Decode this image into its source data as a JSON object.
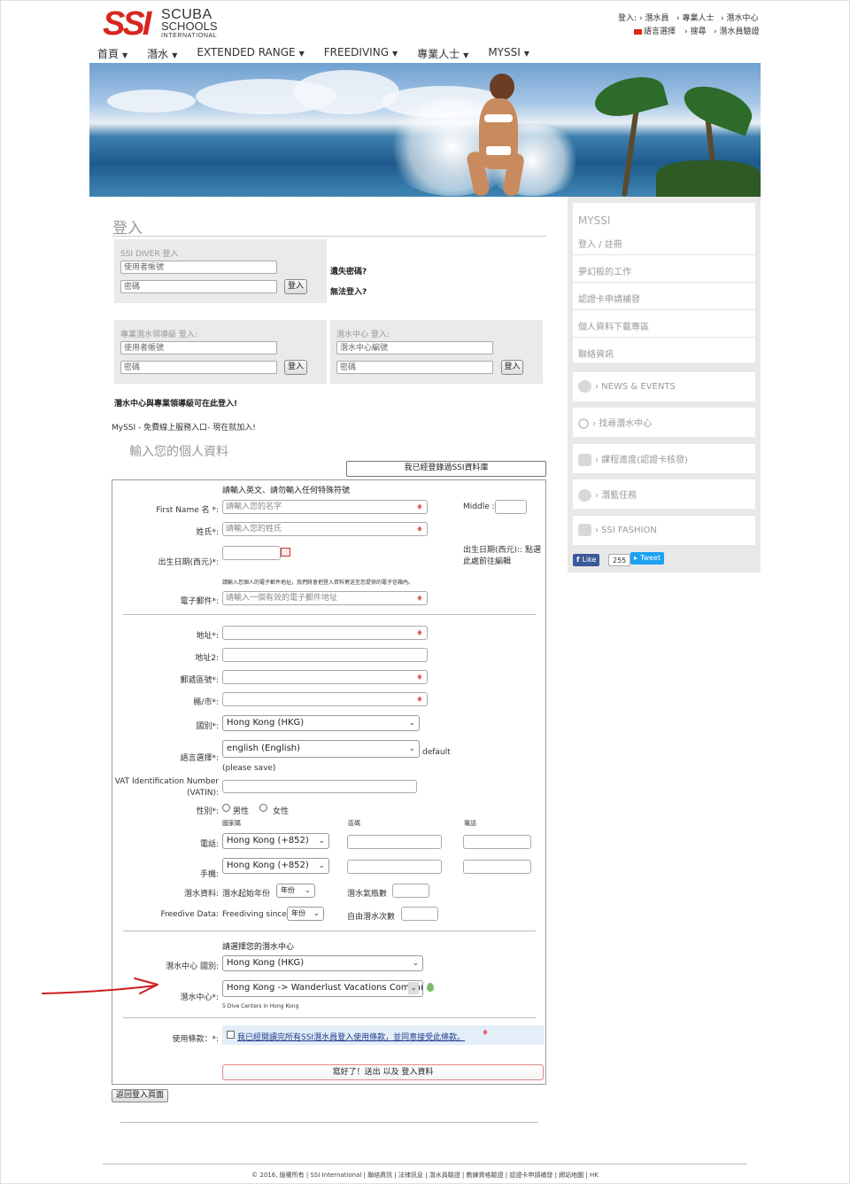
{
  "header": {
    "logo_ssi": "SSI",
    "logo_line1": "SCUBA",
    "logo_line2": "SCHOOLS",
    "logo_line3": "INTERNATIONAL",
    "top_login_label": "登入:",
    "top_links": [
      "› 潛水員",
      "› 專業人士",
      "› 潛水中心"
    ],
    "language_label": "語言選擇",
    "search_label": "› 搜尋",
    "verify_label": "› 潛水員驗證",
    "nav": [
      "首頁",
      "潛水",
      "EXTENDED RANGE",
      "FREEDIVING",
      "專業人士",
      "MYSSI"
    ]
  },
  "login": {
    "title": "登入",
    "diver_label": "SSI DIVER 登入",
    "account_placeholder": "使用者帳號",
    "password_placeholder": "密碼",
    "login_button": "登入",
    "forgot_password": "遺失密碼?",
    "cannot_login": "無法登入?",
    "pro_label": "專業潛水領導級 登入:",
    "center_label": "潛水中心 登入:",
    "center_id_placeholder": "潛水中心編號",
    "center_note": "潛水中心與專業領導級可在此登入!",
    "myssi_note": "MySSI - 免費線上服務入口- 現在就加入!"
  },
  "form": {
    "title": "輸入您的個人資料",
    "registered_button": "我已經登錄過SSI資料庫",
    "instruction": "請輸入英文、請勿輸入任何特殊符號",
    "first_name_label": "First Name 名 *:",
    "first_name_placeholder": "請輸入您的名字",
    "middle_label": "Middle :",
    "last_name_label": "姓氏*:",
    "last_name_placeholder": "請輸入您的姓氏",
    "dob_label": "出生日期(西元)*:",
    "dob_hint_line1": "出生日期(西元):: 點選",
    "dob_hint_line2": "此處前往編輯",
    "email_note": "請輸入您個人的電子郵件地址，我們將會把登入資料寄送至您提供的電子信箱內。",
    "email_label": "電子郵件*:",
    "email_placeholder": "請輸入一個有效的電子郵件地址",
    "address_label": "地址*:",
    "address2_label": "地址2:",
    "postal_label": "郵遞區號*:",
    "city_label": "縣/市*:",
    "country_label": "國別*:",
    "country_value": "Hong Kong (HKG)",
    "language_label": "語言選擇*:",
    "language_value": "english (English)",
    "language_default": "default",
    "please_save": "(please save)",
    "vat_label_line1": "VAT Identification Number",
    "vat_label_line2": "(VATIN):",
    "gender_label": "性別*:",
    "gender_male": "男性",
    "gender_female": "女性",
    "col_country_code": "國家碼",
    "col_area_code": "區碼",
    "col_phone": "電話",
    "phone_label": "電話:",
    "phone_value": "Hong Kong (+852)",
    "mobile_label": "手機:",
    "mobile_value": "Hong Kong (+852)",
    "dive_data_label": "潛水資料:",
    "dive_since_label": "潛水起始年份",
    "year_value": "年份",
    "dive_count_label": "潛水氣瓶數",
    "freedive_label": "Freedive Data:",
    "freediving_since_label": "Freediving since",
    "freedive_count_label": "自由潛水次數",
    "select_center_title": "請選擇您的潛水中心",
    "center_country_label": "潛水中心 國別:",
    "center_country_value": "Hong Kong (HKG)",
    "center_label": "潛水中心*:",
    "center_value": "Hong Kong -> Wanderlust Vacations Compan",
    "center_count": "5 Dive Centers in Hong Kong",
    "terms_label": "使用條款：*:",
    "terms_text": "我已經閱讀完所有SSI潛水員登入使用條款，並同意接受此條款。",
    "submit_button": "寫好了！送出 以及 登入資料",
    "back_button": "返回登入頁面"
  },
  "sidebar": {
    "myssi_title": "MYSSI",
    "menu": [
      "登入 / 註冊",
      "夢幻般的工作",
      "認證卡申請補發",
      "個人資料下載專區",
      "聯絡資訊"
    ],
    "cards": [
      "› NEWS & EVENTS",
      "› 找尋潛水中心",
      "› 課程進度(認證卡核發)",
      "› 潛藍任務",
      "› SSI FASHION"
    ],
    "like_label": "Like",
    "like_count": "255",
    "tweet_label": "Tweet"
  },
  "footer": {
    "text": "© 2016, 版權所有 | SSI International | 聯絡資訊 | 法律訊息 | 潛水員驗證 | 教練資格驗證 | 認證卡申請補發 | 網站地圖 | HK"
  },
  "colors": {
    "brand_red": "#d7261e",
    "box_gray": "#eaeaea",
    "sidebar_gray": "#e8e8e8",
    "arrow_red": "#cc1f1f",
    "facebook_blue": "#3b5998",
    "twitter_blue": "#1da1f2"
  }
}
